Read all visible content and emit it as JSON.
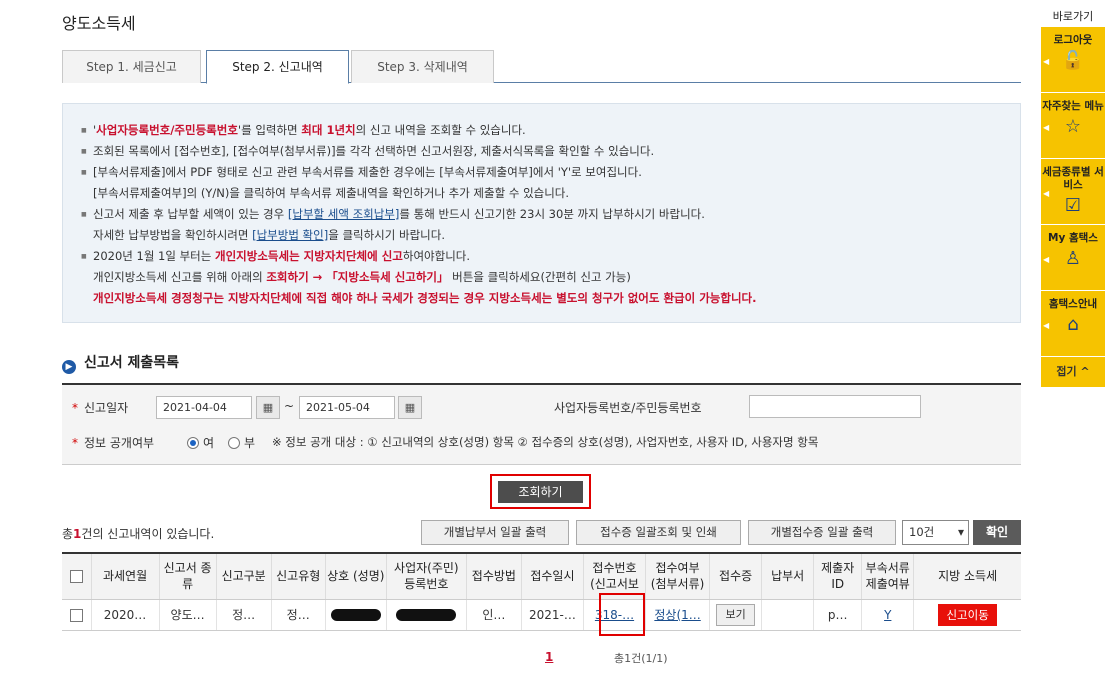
{
  "page_title": "양도소득세",
  "tabs": [
    {
      "label": "Step 1. 세금신고"
    },
    {
      "label": "Step 2. 신고내역"
    },
    {
      "label": "Step 3. 삭제내역"
    }
  ],
  "info": {
    "l1a": "'",
    "l1_red": "사업자등록번호/주민등록번호",
    "l1b": "'를 입력하면 ",
    "l1_red2": "최대 1년치",
    "l1c": "의 신고 내역을 조회할 수 있습니다.",
    "l2": "조회된 목록에서 [접수번호], [접수여부(첨부서류)]를 각각 선택하면 신고서원장, 제출서식목록을 확인할 수 있습니다.",
    "l3": "[부속서류제출]에서 PDF 형태로 신고 관련 부속서류를 제출한 경우에는 [부속서류제출여부]에서 'Y'로 보여집니다.",
    "l4": "[부속서류제출여부]의 (Y/N)을 클릭하여 부속서류 제출내역을 확인하거나 추가 제출할 수 있습니다.",
    "l5a": "신고서 제출 후 납부할 세액이 있는 경우 ",
    "l5_link": "[납부할 세액 조회납부]",
    "l5b": "를 통해 반드시 신고기한 23시 30분 까지 납부하시기 바랍니다.",
    "l6a": "자세한 납부방법을 확인하시려면 ",
    "l6_link": "[납부방법 확인]",
    "l6b": "을 클릭하시기 바랍니다.",
    "l7a": "2020년 1월 1일 부터는 ",
    "l7_red": "개인지방소득세는 지방자치단체에 신고",
    "l7b": "하여야합니다.",
    "l8a": "개인지방소득세 신고를 위해 아래의 ",
    "l8_red": "조회하기 → 「지방소득세 신고하기」",
    "l8b": " 버튼을 클릭하세요(간편히 신고 가능)",
    "l9_red": "개인지방소득세 경정청구는 지방자치단체에 직접 해야 하나 국세가 경정되는 경우 지방소득세는 별도의 청구가 없어도 환급이 가능합니다."
  },
  "section_title": "신고서 제출목록",
  "search": {
    "date_label": "신고일자",
    "date_from": "2021-04-04",
    "tilde": "~",
    "date_to": "2021-05-04",
    "id_label": "사업자등록번호/주민등록번호",
    "id_value": "",
    "disclosure_label": "정보 공개여부",
    "yes": "여",
    "no": "부",
    "note": "※ 정보 공개 대상 : ① 신고내역의 상호(성명) 항목 ② 접수증의 상호(성명), 사업자번호, 사용자 ID, 사용자명 항목",
    "search_button": "조회하기"
  },
  "result": {
    "count_a": "총",
    "count_n": "1",
    "count_b": "건의 신고내역이 있습니다.",
    "btn_bulk_payment": "개별납부서 일괄 출력",
    "btn_bulk_receipt": "접수증 일괄조회 및 인쇄",
    "btn_bulk_receipt_print": "개별접수증 일괄 출력",
    "page_size": "10건",
    "confirm": "확인"
  },
  "table": {
    "headers": [
      "과세연월",
      "신고서 종류",
      "신고구분",
      "신고유형",
      "상호 (성명)",
      "사업자(주민) 등록번호",
      "접수방법",
      "접수일시",
      "접수번호 (신고서보",
      "접수여부 (첨부서류)",
      "접수증",
      "납부서",
      "제출자 ID",
      "부속서류 제출여뷰",
      "지방 소득세"
    ],
    "row": {
      "period": "2020…",
      "kind": "양도…",
      "division": "정…",
      "type": "정…",
      "method": "인…",
      "datetime": "2021-…",
      "receipt_no": "318-…",
      "status": "정상(1…",
      "view": "보기",
      "submitter": "p…",
      "attach": "Y",
      "local_tax": "신고이동"
    }
  },
  "pager": {
    "current": "1",
    "total": "총1건(1/1)"
  },
  "quick": {
    "title": "바로가기",
    "items": [
      {
        "label": "로그아웃",
        "icon": "unlock-icon"
      },
      {
        "label": "자주찾는 메뉴",
        "icon": "star-icon"
      },
      {
        "label": "세금종류별 서비스",
        "icon": "checklist-icon"
      },
      {
        "label": "My 홈택스",
        "icon": "user-icon"
      },
      {
        "label": "홈택스안내",
        "icon": "home-icon"
      }
    ],
    "fold": "접기 ^"
  }
}
